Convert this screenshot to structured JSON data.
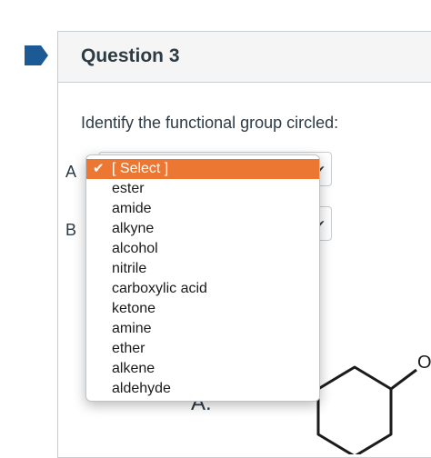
{
  "question": {
    "title": "Question 3",
    "prompt": "Identify the functional group circled:"
  },
  "rows": [
    {
      "label": "A"
    },
    {
      "label": "B"
    }
  ],
  "dropdown": {
    "selected": "[ Select ]",
    "options": [
      "ester",
      "amide",
      "alkyne",
      "alcohol",
      "nitrile",
      "carboxylic acid",
      "ketone",
      "amine",
      "ether",
      "alkene",
      "aldehyde"
    ]
  },
  "figure": {
    "label": "A.",
    "atom": "O"
  },
  "colors": {
    "accent": "#ec7733",
    "flag": "#1c5a96",
    "text": "#2d3b45",
    "border": "#c7cdd1"
  }
}
